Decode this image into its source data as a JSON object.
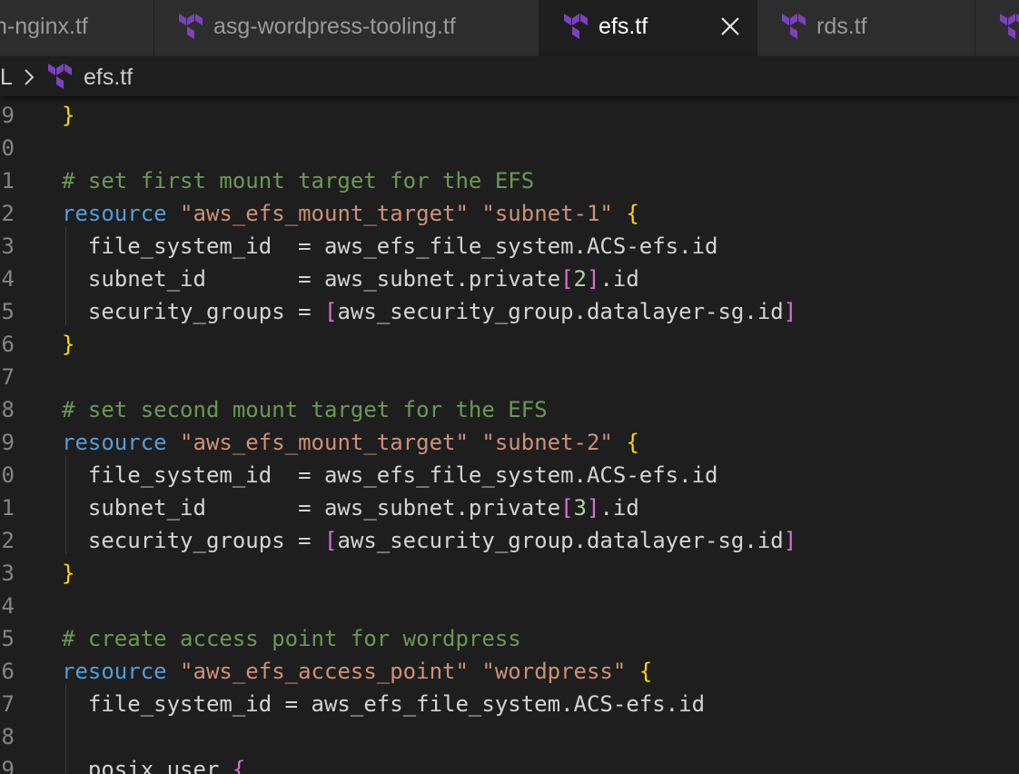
{
  "tabs": [
    {
      "label": "n-nginx.tf",
      "active": false,
      "icon": "terraform-icon"
    },
    {
      "label": "asg-wordpress-tooling.tf",
      "active": false,
      "icon": "terraform-icon"
    },
    {
      "label": "efs.tf",
      "active": true,
      "icon": "terraform-icon"
    },
    {
      "label": "rds.tf",
      "active": false,
      "icon": "terraform-icon"
    }
  ],
  "breadcrumb": {
    "parent": "L",
    "file": "efs.tf"
  },
  "colors": {
    "terraform_icon": "#7b42bc",
    "comment": "#6a9955",
    "keyword": "#569cd6",
    "string": "#ce9178",
    "bracket_outer": "#ffd700",
    "bracket_inner": "#da70d6",
    "number": "#b5cea8"
  },
  "editor": {
    "lines": [
      {
        "n": "9",
        "parts": [
          {
            "t": "}",
            "c": "br1"
          }
        ]
      },
      {
        "n": "0",
        "parts": []
      },
      {
        "n": "1",
        "parts": [
          {
            "t": "# set first mount target for the EFS",
            "c": "comment"
          }
        ]
      },
      {
        "n": "2",
        "parts": [
          {
            "t": "resource",
            "c": "kw"
          },
          {
            "t": " "
          },
          {
            "t": "\"aws_efs_mount_target\"",
            "c": "str"
          },
          {
            "t": " "
          },
          {
            "t": "\"subnet-1\"",
            "c": "str"
          },
          {
            "t": " "
          },
          {
            "t": "{",
            "c": "br1"
          }
        ]
      },
      {
        "n": "3",
        "parts": [
          {
            "t": "  file_system_id  = aws_efs_file_system.ACS-efs.id"
          }
        ]
      },
      {
        "n": "4",
        "parts": [
          {
            "t": "  subnet_id       = aws_subnet.private"
          },
          {
            "t": "[",
            "c": "br2"
          },
          {
            "t": "2",
            "c": "num"
          },
          {
            "t": "]",
            "c": "br2"
          },
          {
            "t": ".id"
          }
        ]
      },
      {
        "n": "5",
        "parts": [
          {
            "t": "  security_groups = "
          },
          {
            "t": "[",
            "c": "br2"
          },
          {
            "t": "aws_security_group.datalayer-sg.id"
          },
          {
            "t": "]",
            "c": "br2"
          }
        ]
      },
      {
        "n": "6",
        "parts": [
          {
            "t": "}",
            "c": "br1"
          }
        ]
      },
      {
        "n": "7",
        "parts": []
      },
      {
        "n": "8",
        "parts": [
          {
            "t": "# set second mount target for the EFS",
            "c": "comment"
          }
        ]
      },
      {
        "n": "9",
        "parts": [
          {
            "t": "resource",
            "c": "kw"
          },
          {
            "t": " "
          },
          {
            "t": "\"aws_efs_mount_target\"",
            "c": "str"
          },
          {
            "t": " "
          },
          {
            "t": "\"subnet-2\"",
            "c": "str"
          },
          {
            "t": " "
          },
          {
            "t": "{",
            "c": "br1"
          }
        ]
      },
      {
        "n": "0",
        "parts": [
          {
            "t": "  file_system_id  = aws_efs_file_system.ACS-efs.id"
          }
        ]
      },
      {
        "n": "1",
        "parts": [
          {
            "t": "  subnet_id       = aws_subnet.private"
          },
          {
            "t": "[",
            "c": "br2"
          },
          {
            "t": "3",
            "c": "num"
          },
          {
            "t": "]",
            "c": "br2"
          },
          {
            "t": ".id"
          }
        ]
      },
      {
        "n": "2",
        "parts": [
          {
            "t": "  security_groups = "
          },
          {
            "t": "[",
            "c": "br2"
          },
          {
            "t": "aws_security_group.datalayer-sg.id"
          },
          {
            "t": "]",
            "c": "br2"
          }
        ]
      },
      {
        "n": "3",
        "parts": [
          {
            "t": "}",
            "c": "br1"
          }
        ]
      },
      {
        "n": "4",
        "parts": []
      },
      {
        "n": "5",
        "parts": [
          {
            "t": "# create access point for wordpress",
            "c": "comment"
          }
        ]
      },
      {
        "n": "6",
        "parts": [
          {
            "t": "resource",
            "c": "kw"
          },
          {
            "t": " "
          },
          {
            "t": "\"aws_efs_access_point\"",
            "c": "str"
          },
          {
            "t": " "
          },
          {
            "t": "\"wordpress\"",
            "c": "str"
          },
          {
            "t": " "
          },
          {
            "t": "{",
            "c": "br1"
          }
        ]
      },
      {
        "n": "7",
        "parts": [
          {
            "t": "  file_system_id = aws_efs_file_system.ACS-efs.id"
          }
        ]
      },
      {
        "n": "8",
        "parts": []
      },
      {
        "n": "9",
        "parts": [
          {
            "t": "  posix_user "
          },
          {
            "t": "{",
            "c": "br2"
          }
        ]
      }
    ]
  }
}
